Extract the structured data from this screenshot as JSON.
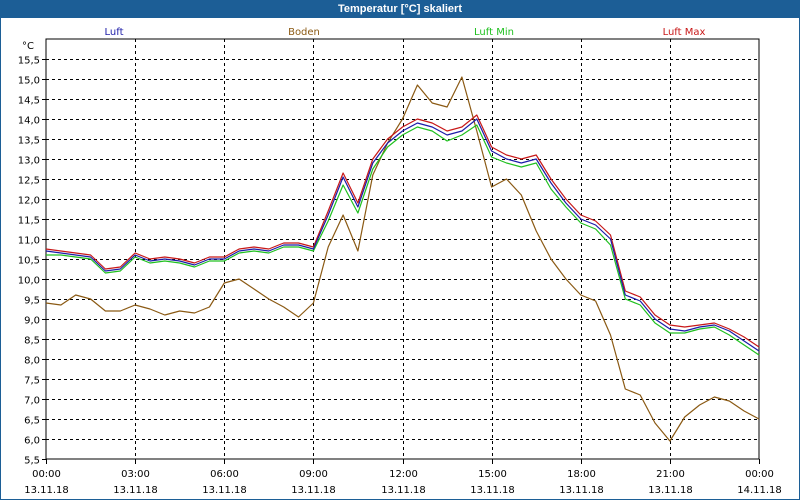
{
  "window": {
    "title": "Temperatur [°C] skaliert"
  },
  "chart_data": {
    "type": "line",
    "title": "Temperatur [°C] skaliert",
    "ylabel": "°C",
    "ylim": [
      5.5,
      16.0
    ],
    "xlim": [
      0,
      24
    ],
    "grid": true,
    "legend_placement": "top",
    "y_ticks": [
      "5,5",
      "6,0",
      "6,5",
      "7,0",
      "7,5",
      "8,0",
      "8,5",
      "9,0",
      "9,5",
      "10,0",
      "10,5",
      "11,0",
      "11,5",
      "12,0",
      "12,5",
      "13,0",
      "13,5",
      "14,0",
      "14,5",
      "15,0",
      "15,5"
    ],
    "x_ticks": [
      {
        "time": "00:00",
        "date": "13.11.18"
      },
      {
        "time": "03:00",
        "date": "13.11.18"
      },
      {
        "time": "06:00",
        "date": "13.11.18"
      },
      {
        "time": "09:00",
        "date": "13.11.18"
      },
      {
        "time": "12:00",
        "date": "13.11.18"
      },
      {
        "time": "15:00",
        "date": "13.11.18"
      },
      {
        "time": "18:00",
        "date": "13.11.18"
      },
      {
        "time": "21:00",
        "date": "13.11.18"
      },
      {
        "time": "00:00",
        "date": "14.11.18"
      }
    ],
    "x_unit": "hours since 00:00 13.11.18",
    "series": [
      {
        "name": "Luft",
        "color": "#1c1ca8",
        "x": [
          0,
          0.5,
          1,
          1.5,
          2,
          2.5,
          3,
          3.5,
          4,
          4.5,
          5,
          5.5,
          6,
          6.5,
          7,
          7.5,
          8,
          8.5,
          9,
          9.5,
          10,
          10.5,
          11,
          11.5,
          12,
          12.5,
          13,
          13.5,
          14,
          14.5,
          15,
          15.5,
          16,
          16.5,
          17,
          17.5,
          18,
          18.5,
          19,
          19.5,
          20,
          20.5,
          21,
          21.5,
          22,
          22.5,
          23,
          23.5,
          24
        ],
        "values": [
          10.7,
          10.65,
          10.6,
          10.55,
          10.2,
          10.25,
          10.6,
          10.45,
          10.5,
          10.45,
          10.35,
          10.5,
          10.5,
          10.7,
          10.75,
          10.7,
          10.85,
          10.85,
          10.75,
          11.6,
          12.55,
          11.8,
          12.9,
          13.4,
          13.7,
          13.9,
          13.8,
          13.6,
          13.7,
          14.0,
          13.2,
          13.0,
          12.9,
          13.0,
          12.4,
          11.9,
          11.5,
          11.35,
          11.0,
          9.6,
          9.45,
          9.0,
          8.75,
          8.7,
          8.8,
          8.85,
          8.7,
          8.45,
          8.2
        ]
      },
      {
        "name": "Boden",
        "color": "#8b5a14",
        "x": [
          0,
          0.5,
          1,
          1.5,
          2,
          2.5,
          3,
          3.5,
          4,
          4.5,
          5,
          5.5,
          6,
          6.5,
          7,
          7.5,
          8,
          8.5,
          9,
          9.5,
          10,
          10.5,
          11,
          11.5,
          12,
          12.5,
          13,
          13.5,
          14,
          14.5,
          15,
          15.5,
          16,
          16.5,
          17,
          17.5,
          18,
          18.5,
          19,
          19.5,
          20,
          20.5,
          21,
          21.5,
          22,
          22.5,
          23,
          23.5,
          24
        ],
        "values": [
          9.4,
          9.35,
          9.6,
          9.5,
          9.2,
          9.2,
          9.35,
          9.25,
          9.1,
          9.2,
          9.15,
          9.3,
          9.9,
          10.0,
          9.75,
          9.5,
          9.3,
          9.05,
          9.4,
          10.8,
          11.6,
          10.7,
          12.6,
          13.4,
          14.0,
          14.85,
          14.4,
          14.3,
          15.05,
          13.7,
          12.3,
          12.5,
          12.1,
          11.2,
          10.5,
          10.0,
          9.6,
          9.45,
          8.6,
          7.25,
          7.1,
          6.4,
          5.95,
          6.55,
          6.85,
          7.05,
          6.95,
          6.7,
          6.5
        ]
      },
      {
        "name": "Luft Min",
        "color": "#20c020",
        "x": [
          0,
          0.5,
          1,
          1.5,
          2,
          2.5,
          3,
          3.5,
          4,
          4.5,
          5,
          5.5,
          6,
          6.5,
          7,
          7.5,
          8,
          8.5,
          9,
          9.5,
          10,
          10.5,
          11,
          11.5,
          12,
          12.5,
          13,
          13.5,
          14,
          14.5,
          15,
          15.5,
          16,
          16.5,
          17,
          17.5,
          18,
          18.5,
          19,
          19.5,
          20,
          20.5,
          21,
          21.5,
          22,
          22.5,
          23,
          23.5,
          24
        ],
        "values": [
          10.6,
          10.6,
          10.55,
          10.5,
          10.15,
          10.2,
          10.55,
          10.4,
          10.45,
          10.4,
          10.3,
          10.45,
          10.45,
          10.65,
          10.7,
          10.65,
          10.8,
          10.8,
          10.7,
          11.45,
          12.35,
          11.65,
          12.75,
          13.3,
          13.6,
          13.8,
          13.7,
          13.45,
          13.6,
          13.85,
          13.05,
          12.9,
          12.8,
          12.9,
          12.25,
          11.8,
          11.4,
          11.25,
          10.85,
          9.5,
          9.35,
          8.9,
          8.65,
          8.65,
          8.75,
          8.8,
          8.6,
          8.35,
          8.1
        ]
      },
      {
        "name": "Luft Max",
        "color": "#c81818",
        "x": [
          0,
          0.5,
          1,
          1.5,
          2,
          2.5,
          3,
          3.5,
          4,
          4.5,
          5,
          5.5,
          6,
          6.5,
          7,
          7.5,
          8,
          8.5,
          9,
          9.5,
          10,
          10.5,
          11,
          11.5,
          12,
          12.5,
          13,
          13.5,
          14,
          14.5,
          15,
          15.5,
          16,
          16.5,
          17,
          17.5,
          18,
          18.5,
          19,
          19.5,
          20,
          20.5,
          21,
          21.5,
          22,
          22.5,
          23,
          23.5,
          24
        ],
        "values": [
          10.75,
          10.7,
          10.65,
          10.6,
          10.25,
          10.3,
          10.65,
          10.5,
          10.55,
          10.5,
          10.4,
          10.55,
          10.55,
          10.75,
          10.8,
          10.75,
          10.9,
          10.9,
          10.8,
          11.7,
          12.65,
          11.9,
          13.0,
          13.5,
          13.8,
          14.0,
          13.9,
          13.7,
          13.8,
          14.1,
          13.3,
          13.1,
          13.0,
          13.1,
          12.5,
          12.0,
          11.6,
          11.45,
          11.1,
          9.7,
          9.55,
          9.1,
          8.85,
          8.8,
          8.85,
          8.9,
          8.75,
          8.55,
          8.3
        ]
      }
    ]
  }
}
